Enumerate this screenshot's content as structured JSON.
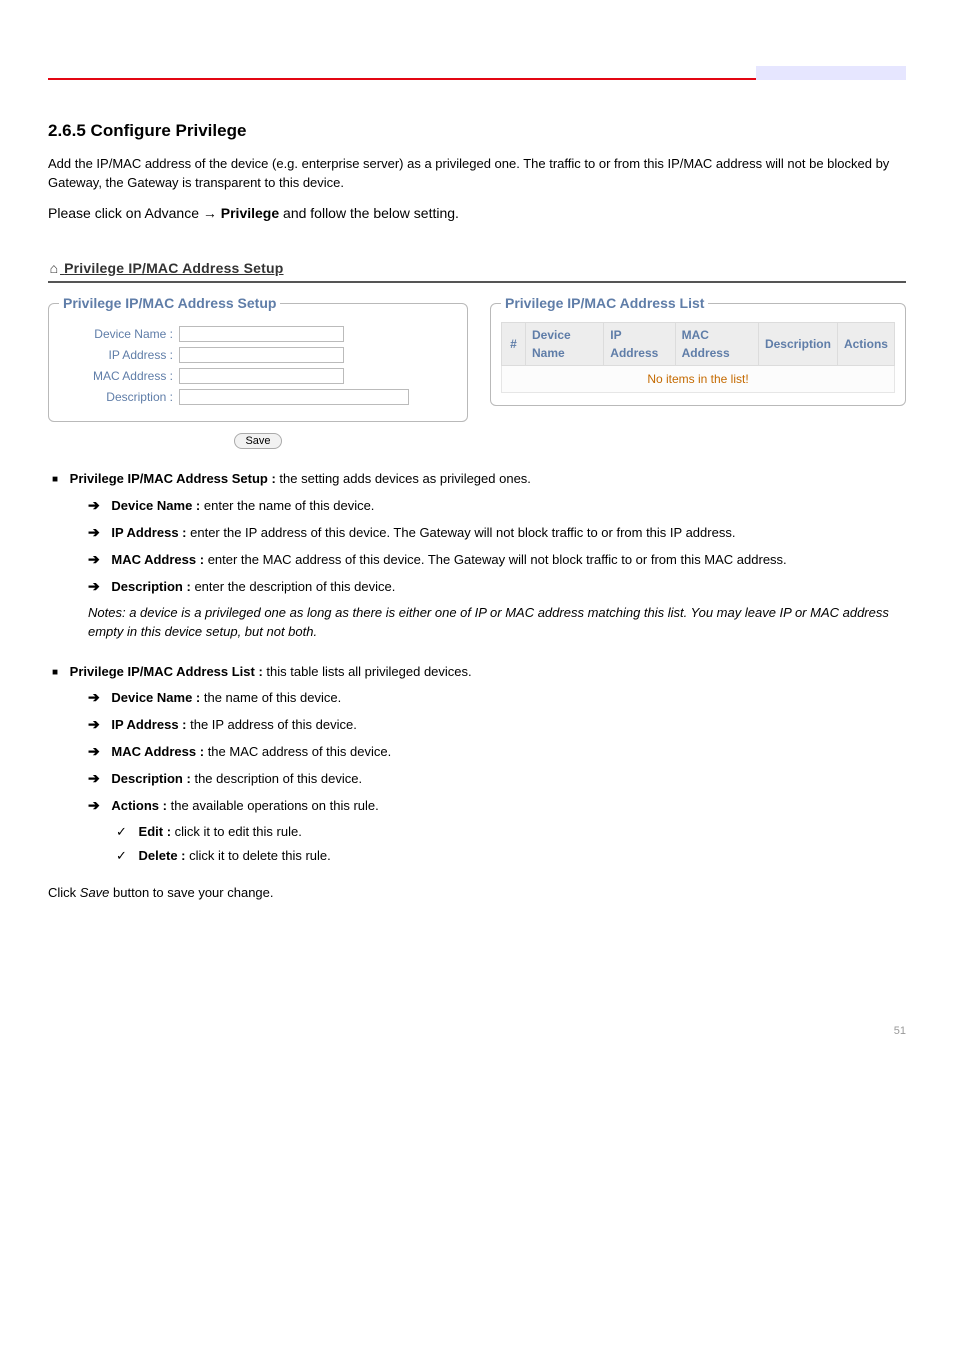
{
  "header": {},
  "doc": {
    "section_number": "2.6.5",
    "section_name": "Configure Privilege",
    "para1": "Add the IP/MAC address of the device (e.g. enterprise server) as a privileged one. The traffic to or from this IP/MAC address will not be blocked by Gateway, the Gateway is transparent to this device.",
    "path_prefix": "Please click on ",
    "path_chain": "Advance → Privilege",
    "path_arrow": " → ",
    "path_last": "Privilege",
    "path_suffix": " and follow the below setting."
  },
  "screenshot": {
    "home_icon": "⌂",
    "title": "Privilege IP/MAC Address Setup",
    "setup_legend": "Privilege IP/MAC Address Setup",
    "list_legend": "Privilege IP/MAC Address List",
    "fields": {
      "device_name_label": "Device Name :",
      "device_name_value": "",
      "ip_label": "IP Address :",
      "ip_value": "",
      "mac_label": "MAC Address :",
      "mac_value": "",
      "desc_label": "Description :",
      "desc_value": ""
    },
    "save_label": "Save",
    "table": {
      "h_idx": "#",
      "h_name": "Device Name",
      "h_ip": "IP Address",
      "h_mac": "MAC Address",
      "h_desc": "Description",
      "h_actions": "Actions",
      "empty": "No items in the list!"
    }
  },
  "setup_block": {
    "title_label": "Privilege IP/MAC Address Setup :",
    "title_rest": " the setting adds devices as privileged ones.",
    "items": {
      "name_label": "Device Name :",
      "name_rest": " enter the name of this device.",
      "ip_label": "IP Address :",
      "ip_rest": " enter the IP address of this device. The Gateway will not block traffic to or from this IP address.",
      "mac_label": "MAC Address :",
      "mac_rest": " enter the MAC address of this device. The Gateway will not block traffic to or from this MAC address.",
      "desc_label": "Description :",
      "desc_rest": " enter the description of this device."
    },
    "note_prefix": "Notes: ",
    "note_text": "a device is a privileged one as long as there is either one of IP or MAC address matching this list. You may leave IP or MAC address empty in this device setup, but not both."
  },
  "list_block": {
    "title_label": "Privilege IP/MAC Address List :",
    "title_rest": " this table lists all privileged devices.",
    "items": {
      "name_label": "Device Name :",
      "name_rest": " the name of this device.",
      "ip_label": "IP Address :",
      "ip_rest": " the IP address of this device.",
      "mac_label": "MAC Address :",
      "mac_rest": " the MAC address of this device.",
      "desc_label": "Description :",
      "desc_rest": " the description of this device.",
      "actions_label": "Actions :",
      "actions_rest": " the available operations on this rule.",
      "edit_label": "Edit :",
      "edit_rest": " click it to edit this rule.",
      "del_label": "Delete :",
      "del_rest": " click it to delete this rule."
    }
  },
  "save_line_prefix": "Click ",
  "save_line_mid": "Save",
  "save_line_suffix": " button to save your change.",
  "page_number": "51"
}
